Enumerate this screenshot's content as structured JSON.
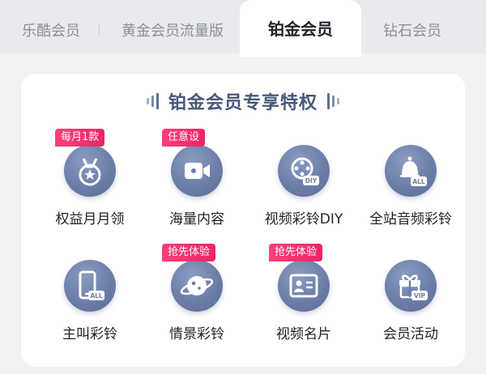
{
  "tabs": [
    {
      "label": "乐酷会员"
    },
    {
      "label": "黄金会员流量版"
    },
    {
      "label": "铂金会员"
    },
    {
      "label": "钻石会员"
    }
  ],
  "active_tab": "铂金会员",
  "panel": {
    "title": "铂金会员专享特权",
    "items": [
      {
        "label": "权益月月领",
        "badge": "每月1款",
        "icon": "medal-icon"
      },
      {
        "label": "海量内容",
        "badge": "任意设",
        "icon": "video-camera-icon"
      },
      {
        "label": "视频彩铃DIY",
        "badge": "",
        "icon": "film-reel-icon",
        "icon_text": "DIY"
      },
      {
        "label": "全站音频彩铃",
        "badge": "",
        "icon": "bell-icon",
        "icon_text": "ALL"
      },
      {
        "label": "主叫彩铃",
        "badge": "",
        "icon": "phone-icon",
        "icon_text": "ALL"
      },
      {
        "label": "情景彩铃",
        "badge": "抢先体验",
        "icon": "planet-icon"
      },
      {
        "label": "视频名片",
        "badge": "抢先体验",
        "icon": "contact-card-icon"
      },
      {
        "label": "会员活动",
        "badge": "",
        "icon": "gift-icon",
        "icon_text": "VIP"
      }
    ]
  },
  "colors": {
    "badge": "#ff3f7b",
    "icon_circle": "#6c7ea8",
    "title": "#465878"
  }
}
